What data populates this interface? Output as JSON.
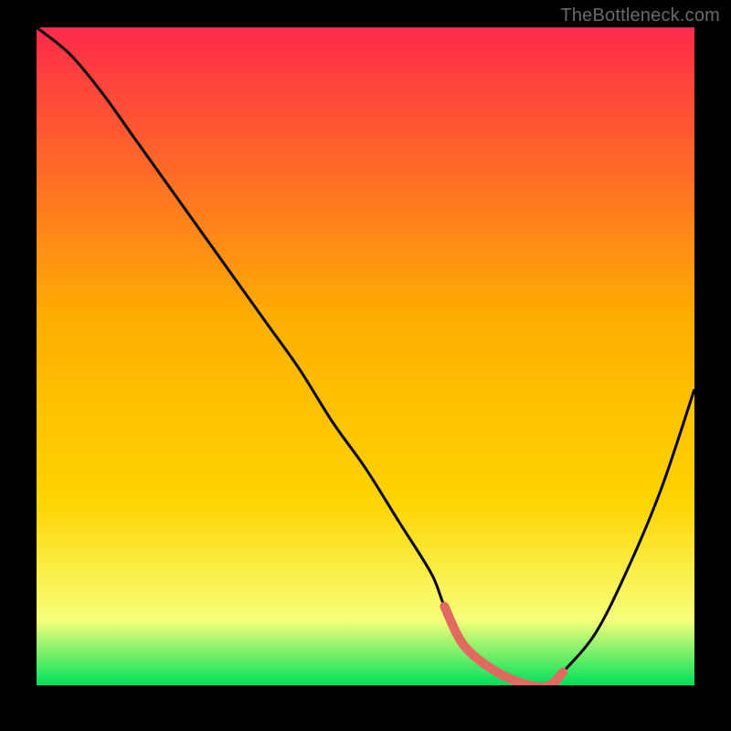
{
  "watermark": "TheBottleneck.com",
  "colors": {
    "background": "#000000",
    "gradient_top": "#ff2a4b",
    "gradient_mid": "#ffd400",
    "gradient_low": "#f7ff7a",
    "gradient_bottom": "#00e05a",
    "curve": "#000000",
    "highlight": "#e2695f"
  },
  "chart_data": {
    "type": "line",
    "title": "",
    "xlabel": "",
    "ylabel": "",
    "xlim": [
      0,
      100
    ],
    "ylim": [
      0,
      100
    ],
    "x": [
      0,
      5,
      10,
      15,
      20,
      25,
      30,
      35,
      40,
      45,
      50,
      55,
      60,
      62,
      65,
      70,
      75,
      78,
      80,
      85,
      90,
      95,
      100
    ],
    "values": [
      100,
      96,
      90,
      83,
      76,
      69,
      62,
      55,
      48,
      40,
      33,
      25,
      17,
      12,
      6,
      2,
      0,
      0,
      2,
      8,
      18,
      30,
      45
    ],
    "highlight_range_x": [
      62,
      80
    ],
    "annotations": []
  }
}
